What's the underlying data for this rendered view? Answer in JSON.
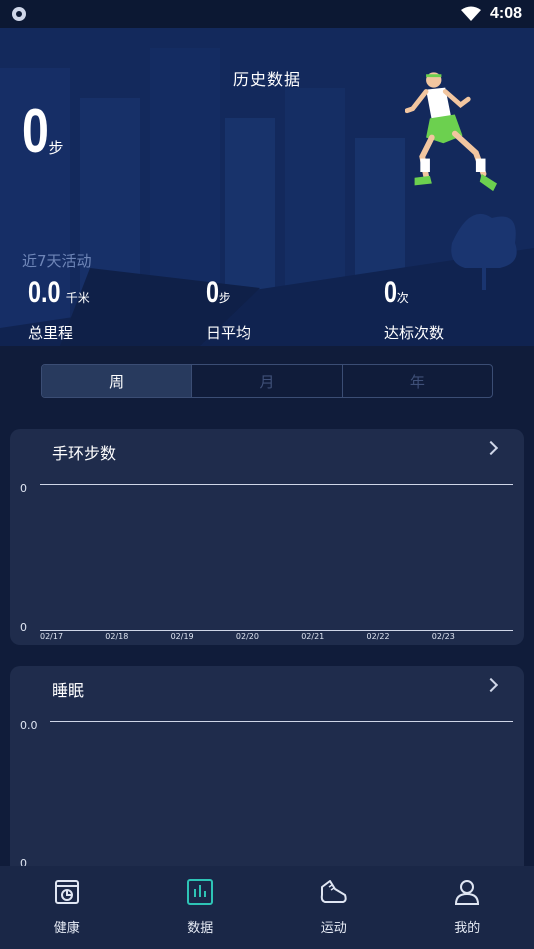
{
  "status_bar": {
    "time": "4:08"
  },
  "header": {
    "title": "历史数据"
  },
  "summary": {
    "steps_value": "0",
    "steps_unit": "步",
    "recent_label": "近7天活动"
  },
  "stats": [
    {
      "value": "0.0",
      "unit": "千米",
      "label": "总里程"
    },
    {
      "value": "0",
      "unit": "步",
      "label": "日平均"
    },
    {
      "value": "0",
      "unit": "次",
      "label": "达标次数"
    }
  ],
  "period_tabs": {
    "items": [
      "周",
      "月",
      "年"
    ],
    "selected": "周"
  },
  "steps_card": {
    "title": "手环步数",
    "y_top": "0",
    "y_bottom": "0",
    "dates": [
      "02/17",
      "02/18",
      "02/19",
      "02/20",
      "02/21",
      "02/22",
      "02/23"
    ]
  },
  "sleep_card": {
    "title": "睡眠",
    "y_top": "0.0",
    "y_bottom": "0"
  },
  "chart_data": [
    {
      "type": "line",
      "title": "手环步数",
      "x": [
        "02/17",
        "02/18",
        "02/19",
        "02/20",
        "02/21",
        "02/22",
        "02/23"
      ],
      "y_tick_labels": [
        "0",
        "0"
      ],
      "series": []
    },
    {
      "type": "line",
      "title": "睡眠",
      "y_tick_labels": [
        "0.0",
        "0"
      ],
      "series": []
    }
  ],
  "bottom_nav": [
    {
      "label": "健康",
      "icon": "health-report-icon"
    },
    {
      "label": "数据",
      "icon": "bar-chart-icon",
      "active": true
    },
    {
      "label": "运动",
      "icon": "sneaker-icon"
    },
    {
      "label": "我的",
      "icon": "user-icon"
    }
  ],
  "colors": {
    "background": "#101c3a",
    "hero": "#13295c",
    "card": "#1f2c4c",
    "nav_active": "#2ec4b6",
    "runner_shorts": "#6cd04f"
  }
}
